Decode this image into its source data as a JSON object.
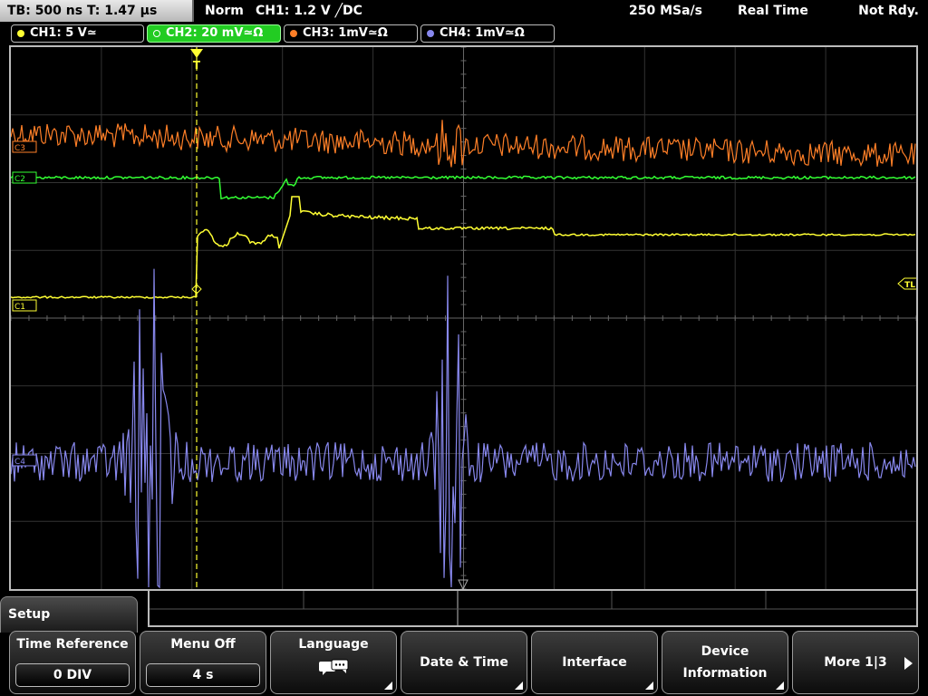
{
  "status": {
    "timebase": "TB: 500 ns   T: 1.47 µs",
    "mode": "Norm",
    "trigger": "CH1: 1.2 V ╱DC",
    "sample_rate": "250 MSa/s",
    "acquisition": "Real Time",
    "state": "Not Rdy."
  },
  "channels": [
    {
      "label": "CH1: 5 V≃",
      "color": "#ffff33"
    },
    {
      "label": "CH2: 20 mV≃Ω",
      "color": "#33ff33"
    },
    {
      "label": "CH3: 1mV≃Ω",
      "color": "#ff7f27"
    },
    {
      "label": "CH4: 1mV≃Ω",
      "color": "#8888ee"
    }
  ],
  "markers": {
    "trigger_top": "T",
    "trigger_level": "TL",
    "ch1": "C1",
    "ch2": "C2",
    "ch3": "C3",
    "ch4": "C4"
  },
  "menu": {
    "title": "Setup",
    "softkeys": [
      {
        "label": "Time Reference",
        "value": "0 DIV"
      },
      {
        "label": "Menu Off",
        "value": "4 s"
      },
      {
        "label": "Language",
        "icon": "speech-bubbles-icon"
      },
      {
        "label": "Date & Time"
      },
      {
        "label": "Interface"
      },
      {
        "label": "Device Information"
      },
      {
        "label": "More 1|3"
      }
    ]
  }
}
